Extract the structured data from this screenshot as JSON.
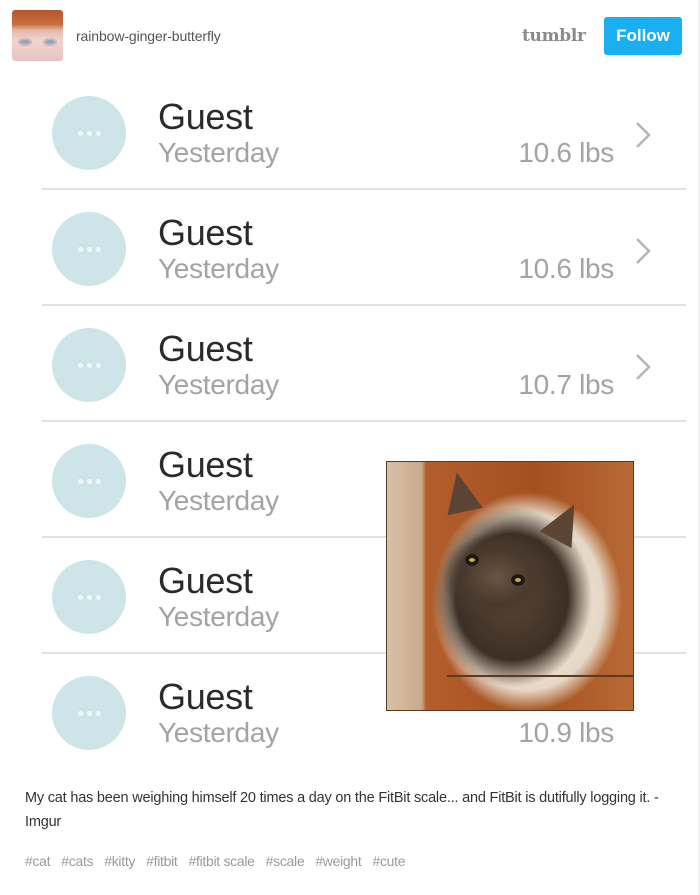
{
  "post": {
    "username": "rainbow-ginger-butterfly",
    "brand": "tumblr",
    "follow_label": "Follow",
    "accent_color": "#1aaef3"
  },
  "log_entries": [
    {
      "name": "Guest",
      "time": "Yesterday",
      "weight": "10.6 lbs"
    },
    {
      "name": "Guest",
      "time": "Yesterday",
      "weight": "10.6 lbs"
    },
    {
      "name": "Guest",
      "time": "Yesterday",
      "weight": "10.7 lbs"
    },
    {
      "name": "Guest",
      "time": "Yesterday",
      "weight": ""
    },
    {
      "name": "Guest",
      "time": "Yesterday",
      "weight": ""
    },
    {
      "name": "Guest",
      "time": "Yesterday",
      "weight": "10.9 lbs"
    }
  ],
  "icons": {
    "avatar": "user-avatar",
    "entry": "ellipsis-circle-icon",
    "chevron": "chevron-right-icon",
    "photo": "cat-photo"
  },
  "caption": "My cat has been weighing himself 20 times a day on the FitBit scale... and FitBit is dutifully logging it. - Imgur",
  "tags": [
    "#cat",
    "#cats",
    "#kitty",
    "#fitbit",
    "#fitbit scale",
    "#scale",
    "#weight",
    "#cute"
  ]
}
